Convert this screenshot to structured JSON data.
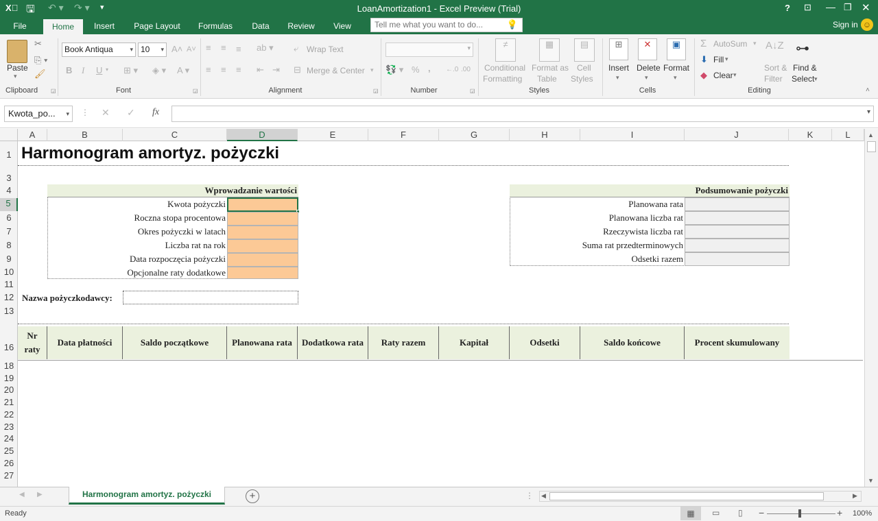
{
  "window": {
    "title": "LoanAmortization1 - Excel Preview (Trial)",
    "help": "?",
    "sign_in": "Sign in"
  },
  "tabs": [
    {
      "label": "File"
    },
    {
      "label": "Home"
    },
    {
      "label": "Insert"
    },
    {
      "label": "Page Layout"
    },
    {
      "label": "Formulas"
    },
    {
      "label": "Data"
    },
    {
      "label": "Review"
    },
    {
      "label": "View"
    }
  ],
  "tell_me": {
    "placeholder": "Tell me what you want to do..."
  },
  "ribbon": {
    "clipboard": {
      "paste": "Paste",
      "group": "Clipboard"
    },
    "font": {
      "name": "Book Antiqua",
      "size": "10",
      "group": "Font",
      "bold": "B",
      "italic": "I",
      "underline": "U"
    },
    "alignment": {
      "wrap_text": "Wrap Text",
      "merge_center": "Merge & Center",
      "group": "Alignment"
    },
    "number": {
      "format": "",
      "percent": "%",
      "comma": ",",
      "group": "Number"
    },
    "styles": {
      "conditional_1": "Conditional",
      "conditional_2": "Formatting",
      "format_as_1": "Format as",
      "format_as_2": "Table",
      "cell_styles_1": "Cell",
      "cell_styles_2": "Styles",
      "group": "Styles"
    },
    "cells": {
      "insert": "Insert",
      "delete": "Delete",
      "format": "Format",
      "group": "Cells"
    },
    "editing": {
      "autosum": "AutoSum",
      "fill": "Fill",
      "clear": "Clear",
      "sort_1": "Sort &",
      "sort_2": "Filter",
      "find_1": "Find &",
      "find_2": "Select",
      "group": "Editing"
    }
  },
  "formula_bar": {
    "name_box": "Kwota_po...",
    "formula": "",
    "fx": "fx"
  },
  "columns": [
    "A",
    "B",
    "C",
    "D",
    "E",
    "F",
    "G",
    "H",
    "I",
    "J",
    "K",
    "L"
  ],
  "rows": [
    "1",
    "3",
    "4",
    "5",
    "6",
    "7",
    "8",
    "9",
    "10",
    "11",
    "12",
    "13",
    "16",
    "18",
    "19",
    "20",
    "21",
    "22",
    "23",
    "24",
    "25",
    "26",
    "27"
  ],
  "sheet": {
    "title": "Harmonogram amortyz. pożyczki",
    "input_header": "Wprowadzanie wartości",
    "input_labels": [
      "Kwota pożyczki",
      "Roczna stopa procentowa",
      "Okres pożyczki w latach",
      "Liczba rat na rok",
      "Data rozpoczęcia pożyczki",
      "Opcjonalne raty dodatkowe"
    ],
    "summary_header": "Podsumowanie pożyczki",
    "summary_labels": [
      "Planowana rata",
      "Planowana liczba rat",
      "Rzeczywista liczba rat",
      "Suma rat przedterminowych",
      "Odsetki razem"
    ],
    "lender_label": "Nazwa pożyczkodawcy:",
    "table_headers": [
      "Nr raty",
      "Data płatności",
      "Saldo początkowe",
      "Planowana rata",
      "Dodatkowa rata",
      "Raty razem",
      "Kapitał",
      "Odsetki",
      "Saldo końcowe",
      "Procent skumulowany"
    ]
  },
  "sheet_tab": {
    "name": "Harmonogram amortyz. pożyczki"
  },
  "status": {
    "ready": "Ready",
    "zoom": "100%"
  },
  "colors": {
    "excel_green": "#217346",
    "input_fill": "#fcc996",
    "header_fill": "#ebf1de",
    "summary_fill": "#f0f0f0"
  }
}
